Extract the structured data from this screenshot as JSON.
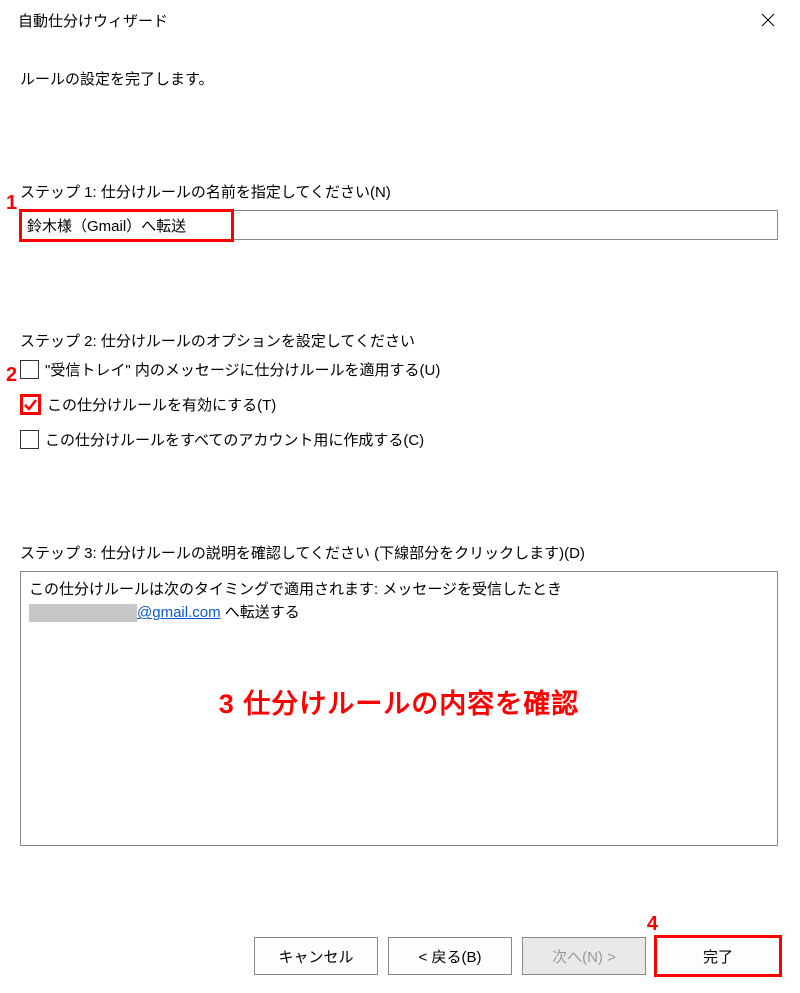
{
  "window": {
    "title": "自動仕分けウィザード"
  },
  "intro": "ルールの設定を完了します。",
  "step1": {
    "label": "ステップ 1: 仕分けルールの名前を指定してください(N)",
    "value": "鈴木様（Gmail）へ転送"
  },
  "step2": {
    "label": "ステップ 2: 仕分けルールのオプションを設定してください",
    "options": [
      {
        "label": "\"受信トレイ\" 内のメッセージに仕分けルールを適用する(U)",
        "checked": false
      },
      {
        "label": "この仕分けルールを有効にする(T)",
        "checked": true
      },
      {
        "label": "この仕分けルールをすべてのアカウント用に作成する(C)",
        "checked": false
      }
    ]
  },
  "step3": {
    "label": "ステップ 3: 仕分けルールの説明を確認してください (下線部分をクリックします)(D)",
    "line1": "この仕分けルールは次のタイミングで適用されます: メッセージを受信したとき",
    "link": "@gmail.com",
    "line2_suffix": " へ転送する"
  },
  "annotations": {
    "n1": "1",
    "n2": "2",
    "n3": "3 仕分けルールの内容を確認",
    "n4": "4"
  },
  "buttons": {
    "cancel": "キャンセル",
    "back": "< 戻る(B)",
    "next": "次へ(N) >",
    "finish": "完了"
  }
}
